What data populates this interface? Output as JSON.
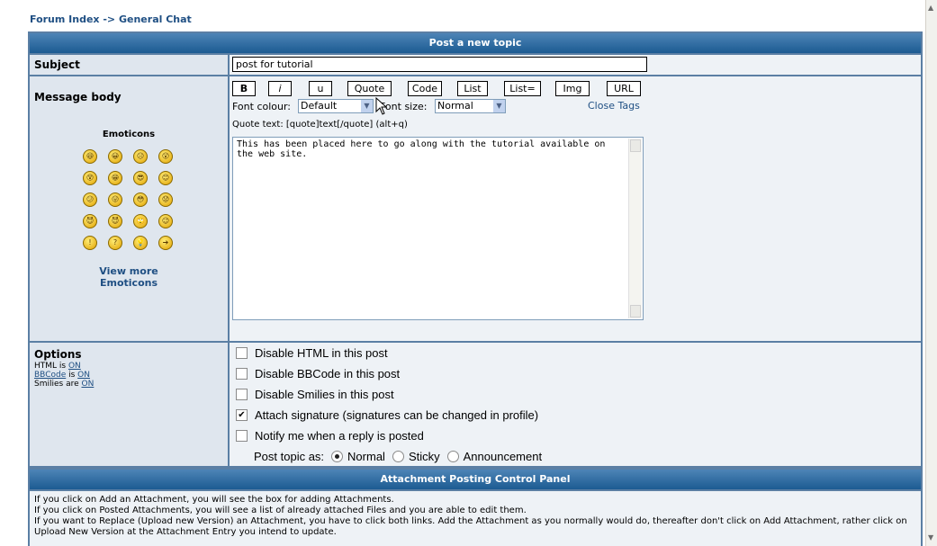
{
  "breadcrumb": {
    "forum_index": "Forum Index",
    "separator": " -> ",
    "forum": "General Chat"
  },
  "post_header": "Post a new topic",
  "subject": {
    "label": "Subject",
    "value": "post for tutorial"
  },
  "message": {
    "label": "Message body",
    "buttons": [
      "B",
      "i",
      "u",
      "Quote",
      "Code",
      "List",
      "List=",
      "Img",
      "URL"
    ],
    "font_colour_label": "Font colour:",
    "font_colour_value": "Default",
    "font_size_label": "Font size:",
    "font_size_value": "Normal",
    "close_tags": "Close Tags",
    "hint": "Quote text: [quote]text[/quote]  (alt+q)",
    "body": "This has been placed here to go along with the tutorial available on the web site."
  },
  "emoticons": {
    "title": "Emoticons",
    "icons": [
      "laugh-icon",
      "big-grin-icon",
      "sad-icon",
      "shocked-icon",
      "eek-icon",
      "grin-icon",
      "cool-icon",
      "smile-icon",
      "confused-icon",
      "razz-icon",
      "embarrassed-icon",
      "sad2-icon",
      "evil-icon",
      "twisted-icon",
      "rolleyes-icon",
      "wink-icon",
      "exclaim-icon",
      "question-icon",
      "idea-icon",
      "arrow-icon"
    ],
    "icon_glyphs": [
      "😆",
      "😀",
      "☹",
      "😲",
      "😵",
      "😁",
      "😎",
      "😊",
      "😕",
      "😛",
      "😳",
      "😟",
      "😈",
      "😈",
      "🙄",
      "😉",
      "!",
      "?",
      "💡",
      "➔"
    ],
    "view_more_1": "View more",
    "view_more_2": "Emoticons"
  },
  "options": {
    "title": "Options",
    "html_prefix": "HTML is ",
    "html_state": "ON",
    "bbcode_link": "BBCode",
    "bbcode_mid": " is ",
    "bbcode_state": "ON",
    "smilies_prefix": "Smilies are ",
    "smilies_state": "ON",
    "checkboxes": [
      {
        "label": "Disable HTML in this post",
        "checked": false
      },
      {
        "label": "Disable BBCode in this post",
        "checked": false
      },
      {
        "label": "Disable Smilies in this post",
        "checked": false
      },
      {
        "label": "Attach signature (signatures can be changed in profile)",
        "checked": true
      },
      {
        "label": "Notify me when a reply is posted",
        "checked": false
      }
    ],
    "post_as_label": "Post topic as:",
    "post_as_options": [
      {
        "label": "Normal",
        "selected": true
      },
      {
        "label": "Sticky",
        "selected": false
      },
      {
        "label": "Announcement",
        "selected": false
      }
    ]
  },
  "attachment": {
    "header": "Attachment Posting Control Panel",
    "lines": [
      "If you click on Add an Attachment, you will see the box for adding Attachments.",
      "If you click on Posted Attachments, you will see a list of already attached Files and you are able to edit them.",
      "If you want to Replace (Upload new Version) an Attachment, you have to click both links. Add the Attachment as you normally would do, thereafter don't click on Add Attachment, rather click on Upload New Version at the Attachment Entry you intend to update."
    ]
  },
  "check_glyph": "✔",
  "colors": {
    "header_bg": "#1c5b92",
    "link": "#1f4f83",
    "border": "#5b7fa4"
  }
}
